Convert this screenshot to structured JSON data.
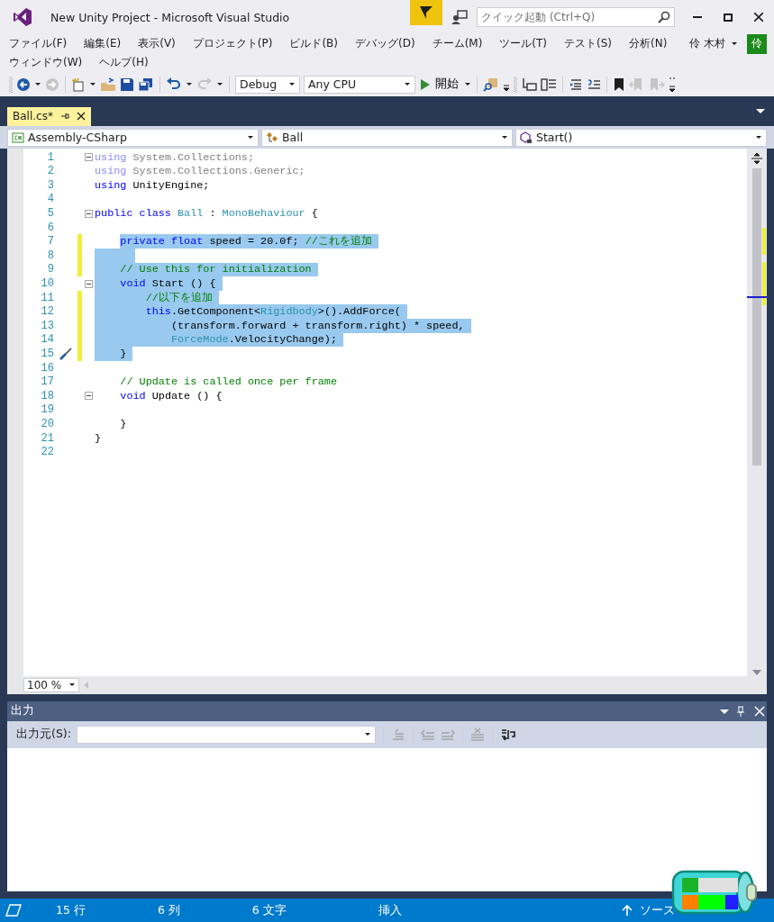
{
  "window": {
    "title": "New Unity Project - Microsoft Visual Studio"
  },
  "quick_launch": {
    "placeholder": "クイック起動 (Ctrl+Q)"
  },
  "account": {
    "name": "伶 木村",
    "avatar": "伶"
  },
  "menu": [
    "ファイル(F)",
    "編集(E)",
    "表示(V)",
    "プロジェクト(P)",
    "ビルド(B)",
    "デバッグ(D)",
    "チーム(M)",
    "ツール(T)",
    "テスト(S)",
    "分析(N)",
    "ウィンドウ(W)",
    "ヘルプ(H)"
  ],
  "toolbar": {
    "configuration": "Debug",
    "platform": "Any CPU",
    "start": "開始"
  },
  "tabs": [
    {
      "label": "Ball.cs*",
      "selected": true
    }
  ],
  "navigation": [
    "Assembly-CSharp",
    "Ball",
    "Start()"
  ],
  "code_lines": [
    {
      "number": "1",
      "fold": true,
      "changed": false,
      "quick_action": false,
      "selected": false,
      "tokens": [
        {
          "kind": "dim_keyword",
          "text": "using"
        },
        {
          "kind": "dim",
          "text": " System.Collections;"
        }
      ]
    },
    {
      "number": "2",
      "fold": false,
      "changed": false,
      "quick_action": false,
      "selected": false,
      "tokens": [
        {
          "kind": "dim_keyword",
          "text": "using"
        },
        {
          "kind": "dim",
          "text": " System.Collections.Generic;"
        }
      ]
    },
    {
      "number": "3",
      "fold": false,
      "changed": false,
      "quick_action": false,
      "selected": false,
      "tokens": [
        {
          "kind": "keyword",
          "text": "using"
        },
        {
          "kind": "plain",
          "text": " UnityEngine;"
        }
      ]
    },
    {
      "number": "4",
      "fold": false,
      "changed": false,
      "quick_action": false,
      "selected": false
    },
    {
      "number": "5",
      "fold": true,
      "changed": false,
      "quick_action": false,
      "selected": false,
      "tokens": [
        {
          "kind": "keyword",
          "text": "public class "
        },
        {
          "kind": "type",
          "text": "Ball"
        },
        {
          "kind": "plain",
          "text": " : "
        },
        {
          "kind": "type",
          "text": "MonoBehaviour"
        },
        {
          "kind": "plain",
          "text": " {"
        }
      ]
    },
    {
      "number": "6",
      "fold": false,
      "changed": false,
      "quick_action": false,
      "selected": false
    },
    {
      "number": "7",
      "fold": false,
      "changed": true,
      "quick_action": false,
      "selected": true,
      "selection_from_text": true,
      "tokens": [
        {
          "kind": "keyword",
          "text": "    private float"
        },
        {
          "kind": "plain",
          "text": " speed = 20.0f; "
        },
        {
          "kind": "comment",
          "text": "//これを追加"
        }
      ]
    },
    {
      "number": "8",
      "fold": false,
      "changed": true,
      "quick_action": false,
      "selected": true,
      "selection_from_text": false
    },
    {
      "number": "9",
      "fold": false,
      "changed": true,
      "quick_action": false,
      "selected": true,
      "selection_from_text": false,
      "tokens": [
        {
          "kind": "comment",
          "text": "    // Use this for initialization"
        }
      ]
    },
    {
      "number": "10",
      "fold": true,
      "changed": false,
      "quick_action": false,
      "selected": true,
      "selection_from_text": false,
      "tokens": [
        {
          "kind": "keyword",
          "text": "    void"
        },
        {
          "kind": "plain",
          "text": " Start () {"
        }
      ]
    },
    {
      "number": "11",
      "fold": false,
      "changed": true,
      "quick_action": false,
      "selected": true,
      "selection_from_text": false,
      "tokens": [
        {
          "kind": "comment",
          "text": "        //以下を追加"
        }
      ]
    },
    {
      "number": "12",
      "fold": false,
      "changed": true,
      "quick_action": false,
      "selected": true,
      "selection_from_text": false,
      "tokens": [
        {
          "kind": "keyword",
          "text": "        this"
        },
        {
          "kind": "plain",
          "text": ".GetComponent<"
        },
        {
          "kind": "type",
          "text": "Rigidbody"
        },
        {
          "kind": "plain",
          "text": ">().AddForce("
        }
      ]
    },
    {
      "number": "13",
      "fold": false,
      "changed": true,
      "quick_action": false,
      "selected": true,
      "selection_from_text": false,
      "tokens": [
        {
          "kind": "plain",
          "text": "            (transform.forward + transform.right) * speed,"
        }
      ]
    },
    {
      "number": "14",
      "fold": false,
      "changed": true,
      "quick_action": false,
      "selected": true,
      "selection_from_text": false,
      "tokens": [
        {
          "kind": "type",
          "text": "            ForceMode"
        },
        {
          "kind": "plain",
          "text": ".VelocityChange);"
        }
      ]
    },
    {
      "number": "15",
      "fold": false,
      "changed": true,
      "quick_action": true,
      "selected": true,
      "selection_from_text": false,
      "tokens": [
        {
          "kind": "plain",
          "text": "    }"
        }
      ]
    },
    {
      "number": "16",
      "fold": false,
      "changed": false,
      "quick_action": false,
      "selected": false
    },
    {
      "number": "17",
      "fold": false,
      "changed": false,
      "quick_action": false,
      "selected": false,
      "tokens": [
        {
          "kind": "comment",
          "text": "    // Update is called once per frame"
        }
      ]
    },
    {
      "number": "18",
      "fold": true,
      "changed": false,
      "quick_action": false,
      "selected": false,
      "tokens": [
        {
          "kind": "keyword",
          "text": "    void"
        },
        {
          "kind": "plain",
          "text": " Update () {"
        }
      ]
    },
    {
      "number": "19",
      "fold": false,
      "changed": false,
      "quick_action": false,
      "selected": false
    },
    {
      "number": "20",
      "fold": false,
      "changed": false,
      "quick_action": false,
      "selected": false,
      "tokens": [
        {
          "kind": "plain",
          "text": "    }"
        }
      ]
    },
    {
      "number": "21",
      "fold": false,
      "changed": false,
      "quick_action": false,
      "selected": false,
      "tokens": [
        {
          "kind": "plain",
          "text": "}"
        }
      ]
    },
    {
      "number": "22",
      "fold": false,
      "changed": false,
      "quick_action": false,
      "selected": false
    }
  ],
  "zoom": "100 %",
  "output_panel": {
    "title": "出力",
    "source_label": "出力元(S):"
  },
  "status_bar": {
    "line": "15 行",
    "column": "6 列",
    "characters": "6 文字",
    "mode": "挿入",
    "source_control": "ソース"
  }
}
